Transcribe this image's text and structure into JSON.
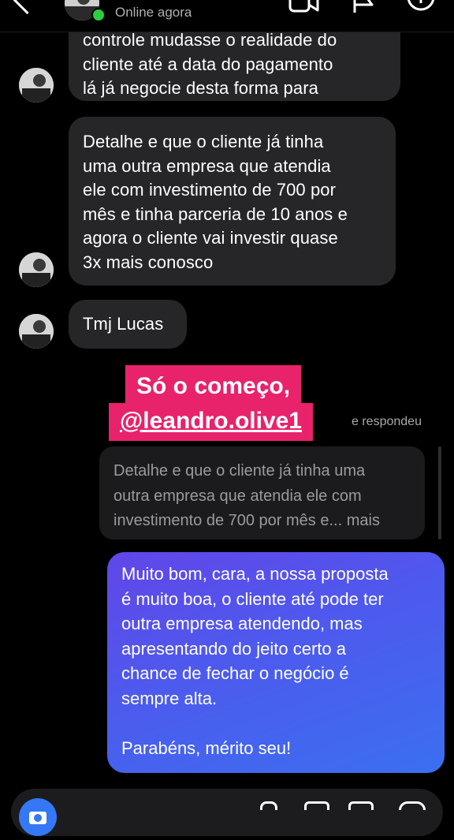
{
  "header": {
    "status": "Online agora",
    "icons": [
      "back-icon",
      "video-call-icon",
      "flag-icon",
      "info-icon"
    ]
  },
  "messages": {
    "m1": {
      "text": "controle mudasse o realidade do\ncliente até a data do pagamento\nlá já negocie desta forma para"
    },
    "m2": {
      "text": "Detalhe e que o cliente já tinha\numa outra empresa que atendia\nele  com investimento de 700 por\nmês e tinha parceria de 10 anos e\nagora o cliente vai investir quase\n3x mais conosco"
    },
    "m3": {
      "text": "Tmj Lucas"
    }
  },
  "reply": {
    "sticker_line1": "Só o começo,",
    "sticker_line2": "@leandro.olive1",
    "replied_label": "e respondeu",
    "quoted_text": "Detalhe e que o cliente já tinha uma\noutra empresa que atendia ele  com\ninvestimento de 700 por mês e... mais"
  },
  "outgoing": {
    "text": "Muito bom, cara, a nossa proposta\né muito boa, o cliente até pode ter\noutra empresa atendendo, mas\napresentando do jeito certo a\nchance de fechar o negócio é\nsempre alta.\n\nParabéns, mérito seu!"
  },
  "colors": {
    "background": "#000000",
    "incoming_bubble": "#262628",
    "outgoing_gradient_start": "#6146e8",
    "outgoing_gradient_end": "#3b6ff0",
    "sticker": "#e8226b",
    "online": "#2ecc40",
    "camera_button": "#3478f6"
  },
  "composer_icons": [
    "camera-icon",
    "mic-icon",
    "gallery-icon",
    "sticker-icon",
    "plus-icon"
  ]
}
